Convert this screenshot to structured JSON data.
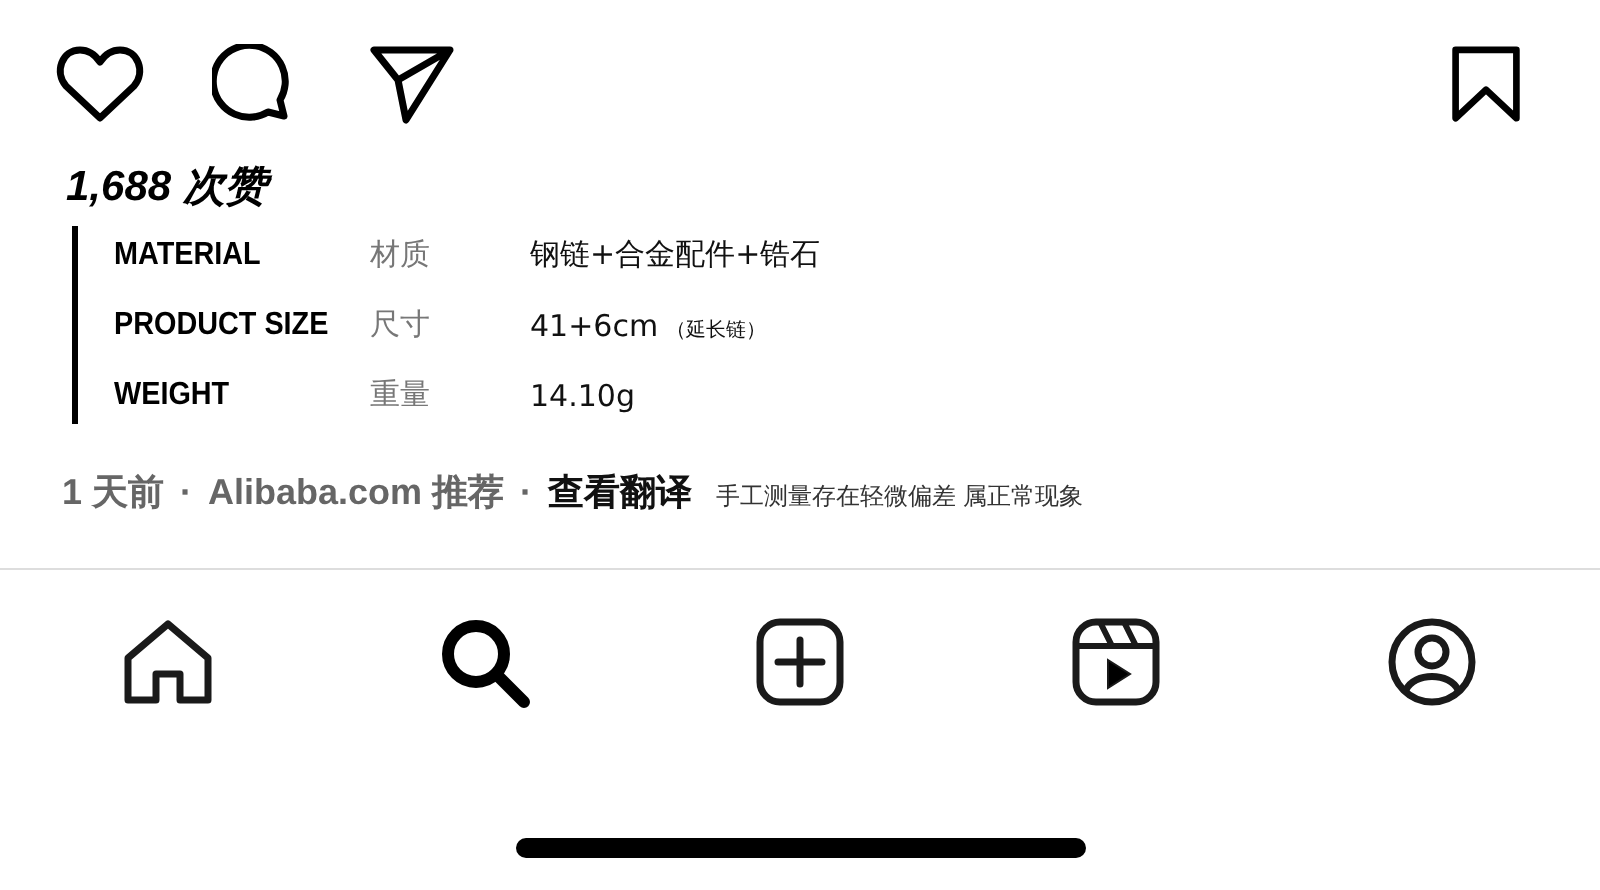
{
  "likes": "1,688 次赞",
  "specs": [
    {
      "label": "MATERIAL",
      "label_cn": "材质",
      "value": "钢链+合金配件+锆石"
    },
    {
      "label": "PRODUCT SIZE",
      "label_cn": "尺寸",
      "value": "41+6cm",
      "note": "（延长链）"
    },
    {
      "label": "WEIGHT",
      "label_cn": "重量",
      "value": "14.10g"
    }
  ],
  "meta": {
    "time": "1 天前",
    "sep1": "·",
    "source": "Alibaba.com 推荐",
    "sep2": "·",
    "translate": "查看翻译",
    "note": "手工测量存在轻微偏差 属正常现象"
  },
  "nav": [
    {
      "kind": "home",
      "selected": false
    },
    {
      "kind": "search",
      "selected": true
    },
    {
      "kind": "create",
      "selected": false
    },
    {
      "kind": "reels",
      "selected": false
    },
    {
      "kind": "profile",
      "selected": false
    }
  ]
}
